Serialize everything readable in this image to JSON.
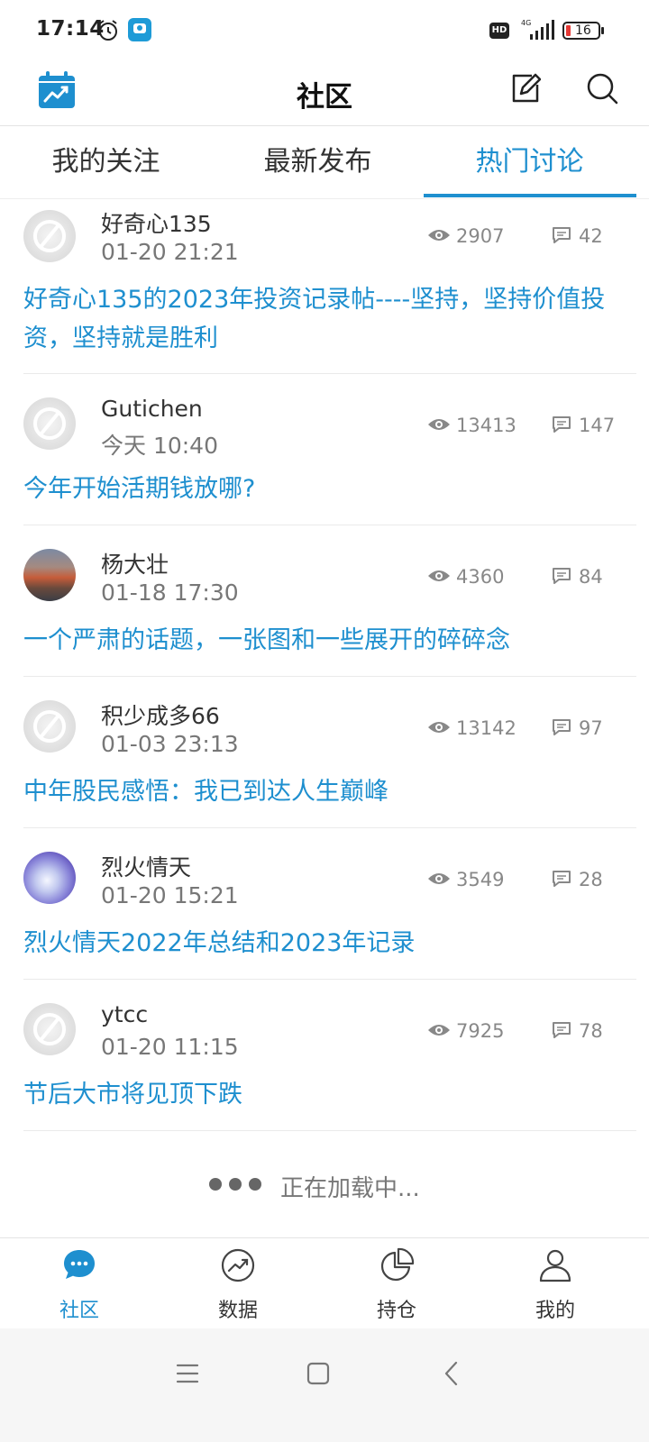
{
  "status_bar": {
    "time": "17:14",
    "network": "4G",
    "hd": "HD",
    "battery": "16"
  },
  "header": {
    "title": "社区",
    "calendar_icon": "calendar-chart-icon",
    "edit_icon": "edit-icon",
    "search_icon": "search-icon"
  },
  "tabs": [
    {
      "label": "我的关注",
      "active": false
    },
    {
      "label": "最新发布",
      "active": false
    },
    {
      "label": "热门讨论",
      "active": true
    }
  ],
  "posts": [
    {
      "username": "好奇心135",
      "time": "01-20 21:21",
      "views": "2907",
      "comments": "42",
      "avatar": "default",
      "title": "好奇心135的2023年投资记录帖----坚持，坚持价值投资，坚持就是胜利"
    },
    {
      "username": "Gutichen",
      "time": "今天 10:40",
      "views": "13413",
      "comments": "147",
      "avatar": "default",
      "title": "今年开始活期钱放哪?"
    },
    {
      "username": "杨大壮",
      "time": "01-18 17:30",
      "views": "4360",
      "comments": "84",
      "avatar": "landscape",
      "title": "一个严肃的话题，一张图和一些展开的碎碎念"
    },
    {
      "username": "积少成多66",
      "time": "01-03 23:13",
      "views": "13142",
      "comments": "97",
      "avatar": "default",
      "title": "中年股民感悟：我已到达人生巅峰"
    },
    {
      "username": "烈火情天",
      "time": "01-20 15:21",
      "views": "3549",
      "comments": "28",
      "avatar": "flower",
      "title": "烈火情天2022年总结和2023年记录"
    },
    {
      "username": "ytcc",
      "time": "01-20 11:15",
      "views": "7925",
      "comments": "78",
      "avatar": "default",
      "title": "节后大市将见顶下跌"
    }
  ],
  "loading": {
    "text": "正在加载中..."
  },
  "bottom_nav": [
    {
      "label": "社区",
      "icon": "chat-bubble-icon",
      "active": true
    },
    {
      "label": "数据",
      "icon": "trend-chart-icon",
      "active": false
    },
    {
      "label": "持仓",
      "icon": "pie-chart-icon",
      "active": false
    },
    {
      "label": "我的",
      "icon": "user-icon",
      "active": false
    }
  ],
  "colors": {
    "accent": "#1e8fcf",
    "text": "#333333",
    "muted": "#888888"
  }
}
